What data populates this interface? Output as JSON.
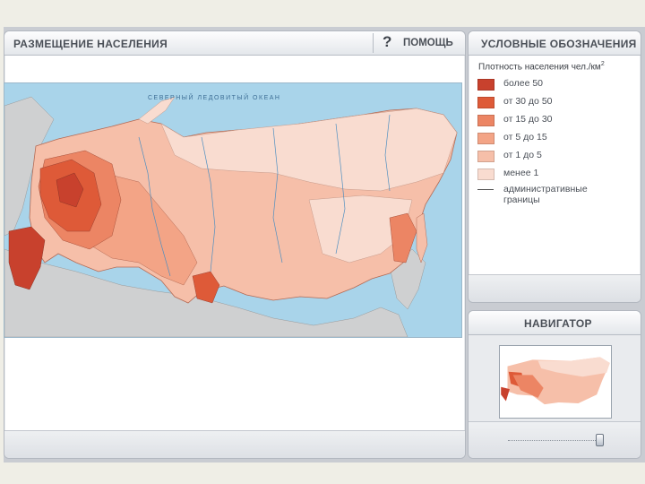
{
  "main": {
    "title": "РАЗМЕЩЕНИЕ НАСЕЛЕНИЯ",
    "help_label": "ПОМОЩЬ",
    "help_glyph": "?"
  },
  "map": {
    "ocean_label": "СЕВЕРНЫЙ ЛЕДОВИТЫЙ ОКЕАН"
  },
  "legend": {
    "title": "УСЛОВНЫЕ ОБОЗНАЧЕНИЯ",
    "caption": "Плотность населения чел./км",
    "caption_sup": "2",
    "items": [
      {
        "label": "более 50",
        "color": "#c8412d"
      },
      {
        "label": "от 30 до 50",
        "color": "#de5a38"
      },
      {
        "label": "от 15 до 30",
        "color": "#ec8564"
      },
      {
        "label": "от 5 до 15",
        "color": "#f3a486"
      },
      {
        "label": "от 1 до 5",
        "color": "#f6bfa9"
      },
      {
        "label": "менее 1",
        "color": "#f9dcd0"
      }
    ],
    "admin_label": "административные границы"
  },
  "navigator": {
    "title": "НАВИГАТОР",
    "zoom_level": 1.0
  },
  "colors": {
    "sea": "#a9d4ea",
    "foreign_land": "#cfd0d1",
    "panel_bg": "#e9ebee"
  }
}
